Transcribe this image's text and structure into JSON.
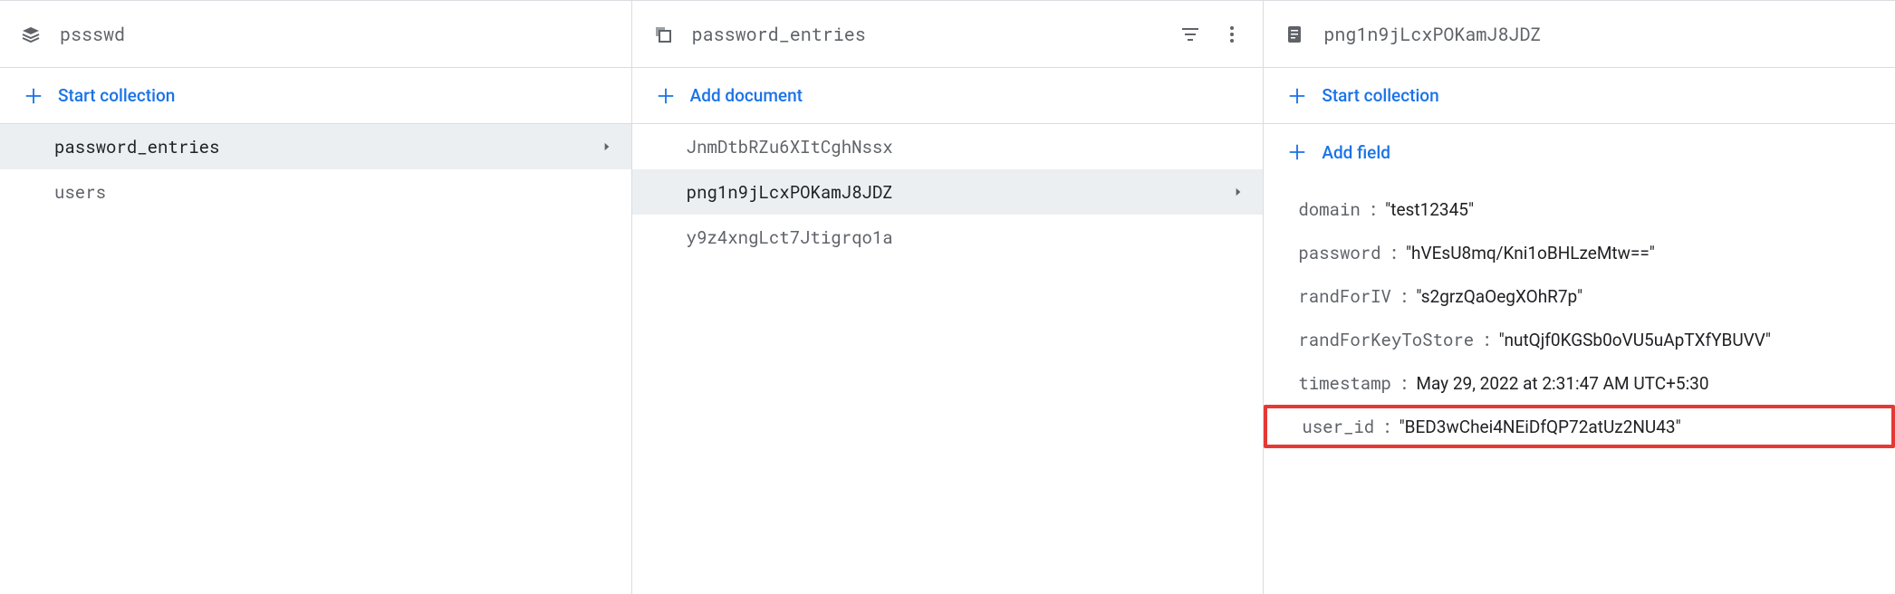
{
  "panel1": {
    "title": "pssswd",
    "action_label": "Start collection",
    "items": [
      {
        "label": "password_entries",
        "selected": true
      },
      {
        "label": "users",
        "selected": false
      }
    ]
  },
  "panel2": {
    "title": "password_entries",
    "action_label": "Add document",
    "items": [
      {
        "label": "JnmDtbRZu6XItCghNssx",
        "selected": false
      },
      {
        "label": "png1n9jLcxPOKamJ8JDZ",
        "selected": true
      },
      {
        "label": "y9z4xngLct7Jtigrqo1a",
        "selected": false
      }
    ]
  },
  "panel3": {
    "title": "png1n9jLcxPOKamJ8JDZ",
    "start_collection_label": "Start collection",
    "add_field_label": "Add field",
    "fields": [
      {
        "key": "domain",
        "value": "\"test12345\"",
        "highlight": false
      },
      {
        "key": "password",
        "value": "\"hVEsU8mq/Kni1oBHLzeMtw==\"",
        "highlight": false
      },
      {
        "key": "randForIV",
        "value": "\"s2grzQaOegXOhR7p\"",
        "highlight": false
      },
      {
        "key": "randForKeyToStore",
        "value": "\"nutQjf0KGSb0oVU5uApTXfYBUVV\"",
        "highlight": false
      },
      {
        "key": "timestamp",
        "value": "May 29, 2022 at 2:31:47 AM UTC+5:30",
        "highlight": false
      },
      {
        "key": "user_id",
        "value": "\"BED3wChei4NEiDfQP72atUz2NU43\"",
        "highlight": true
      }
    ]
  }
}
